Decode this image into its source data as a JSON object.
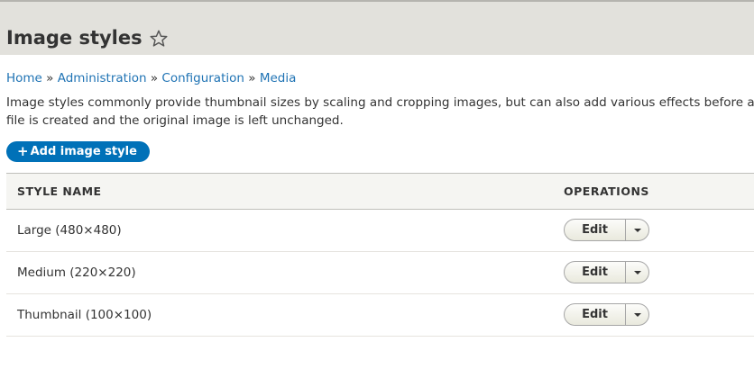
{
  "header": {
    "title": "Image styles"
  },
  "breadcrumb": {
    "items": [
      "Home",
      "Administration",
      "Configuration",
      "Media"
    ],
    "separator": "»"
  },
  "description": {
    "line1": "Image styles commonly provide thumbnail sizes by scaling and cropping images, but can also add various effects before an im",
    "line2": "file is created and the original image is left unchanged."
  },
  "actions": {
    "add_icon": "+",
    "add_label": "Add image style"
  },
  "table": {
    "headers": {
      "name": "STYLE NAME",
      "operations": "OPERATIONS"
    },
    "rows": [
      {
        "name": "Large (480×480)",
        "operation": "Edit"
      },
      {
        "name": "Medium (220×220)",
        "operation": "Edit"
      },
      {
        "name": "Thumbnail (100×100)",
        "operation": "Edit"
      }
    ]
  },
  "icons": {
    "favorite": "star-outline-icon",
    "dropdown": "caret-down-icon"
  },
  "colors": {
    "link": "#1f73b4",
    "primary_button": "#0071b8",
    "header_bg": "#e2e1dc"
  }
}
